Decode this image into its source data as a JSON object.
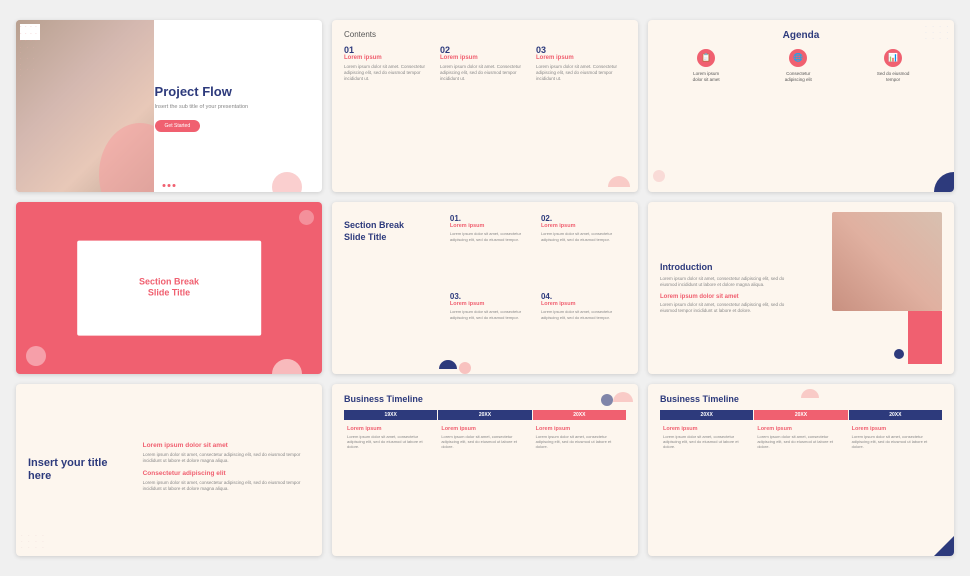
{
  "slides": [
    {
      "id": 1,
      "title": "Project Flow",
      "subtitle": "Insert the sub title of your presentation",
      "button_label": "Get Started",
      "nav_dots": [
        "·",
        "·",
        "·"
      ]
    },
    {
      "id": 2,
      "heading": "Contents",
      "items": [
        {
          "num": "01",
          "title": "Lorem ipsum",
          "text": "Lorem ipsum dolor sit amet. Consectetur adipiscing elit, sed do eiusmod tempor incididunt ut."
        },
        {
          "num": "02",
          "title": "Lorem ipsum",
          "text": "Lorem ipsum dolor sit amet. Consectetur adipiscing elit, sed do eiusmod tempor incididunt ut."
        },
        {
          "num": "03",
          "title": "Lorem ipsum",
          "text": "Lorem ipsum dolor sit amet. Consectetur adipiscing elit, sed do eiusmod tempor incididunt ut."
        }
      ]
    },
    {
      "id": 3,
      "heading": "Agenda",
      "icons": [
        {
          "icon": "📋",
          "label": "Lorem ipsum\ndolor sit amet"
        },
        {
          "icon": "🌐",
          "label": "Consectetur\nadipiscing elit"
        },
        {
          "icon": "📊",
          "label": "Sed do eiusmod\ntempor"
        }
      ]
    },
    {
      "id": 4,
      "title": "Section Break",
      "subtitle": "Slide Title"
    },
    {
      "id": 5,
      "left_title": "Section Break\nSlide Title",
      "items": [
        {
          "num": "01.",
          "title": "Lorem ipsum",
          "text": "Lorem ipsum dolor sit amet, consectetur adipiscing elit, sed do eiusmod tempor."
        },
        {
          "num": "02.",
          "title": "Lorem ipsum",
          "text": "Lorem ipsum dolor sit amet, consectetur adipiscing elit, sed do eiusmod tempor."
        },
        {
          "num": "03.",
          "title": "Lorem ipsum",
          "text": "Lorem ipsum dolor sit amet, consectetur adipiscing elit, sed do eiusmod tempor."
        },
        {
          "num": "04.",
          "title": "Lorem ipsum",
          "text": "Lorem ipsum dolor sit amet, consectetur adipiscing elit, sed do eiusmod tempor."
        }
      ]
    },
    {
      "id": 6,
      "title": "Introduction",
      "text": "Lorem ipsum dolor sit amet, consectetur adipiscing elit, sed do eiusmod incididunt ut labore et dolore magna aliqua.",
      "highlight_title": "Lorem ipsum dolor sit amet",
      "highlight_text": "Lorem ipsum dolor sit amet, consectetur adipiscing elit, sed do eiusmod tempor incididunt ut labore et dolore."
    },
    {
      "id": 7,
      "main_title": "Insert your title\nhere",
      "sections": [
        {
          "title": "Lorem ipsum dolor sit amet",
          "text": "Lorem ipsum dolor sit amet, consectetur adipiscing elit, sed do eiusmod tempor incididunt ut labore et dolore magna aliqua."
        },
        {
          "title": "Consectetur adipiscing elit",
          "text": "Lorem ipsum dolor sit amet, consectetur adipiscing elit, sed do eiusmod tempor incididunt ut labore et dolore magna aliqua."
        }
      ]
    },
    {
      "id": 8,
      "title": "Business Timeline",
      "years": [
        "19XX",
        "20XX",
        "20XX"
      ],
      "year_colors": [
        "dark",
        "dark",
        "pink"
      ],
      "items": [
        {
          "title": "Lorem ipsum",
          "text": "Lorem ipsum dolor sit amet, consectetur adipiscing elit, sed do eiusmod ut labore et dolore."
        },
        {
          "title": "Lorem ipsum",
          "text": "Lorem ipsum dolor sit amet, consectetur adipiscing elit, sed do eiusmod ut labore et dolore."
        },
        {
          "title": "Lorem ipsum",
          "text": "Lorem ipsum dolor sit amet, consectetur adipiscing elit, sed do eiusmod ut labore et dolore."
        }
      ]
    },
    {
      "id": 9,
      "title": "Business Timeline",
      "years": [
        "20XX",
        "20XX",
        "20XX"
      ],
      "year_colors": [
        "dark",
        "pink",
        "dark"
      ],
      "items": [
        {
          "title": "Lorem ipsum",
          "text": "Lorem ipsum dolor sit amet, consectetur adipiscing elit, sed do eiusmod ut labore et dolore."
        },
        {
          "title": "Lorem ipsum",
          "text": "Lorem ipsum dolor sit amet, consectetur adipiscing elit, sed do eiusmod ut labore et dolore."
        },
        {
          "title": "Lorem ipsum",
          "text": "Lorem ipsum dolor sit amet, consectetur adipiscing elit, sed do eiusmod ut labore et dolore."
        }
      ]
    }
  ]
}
